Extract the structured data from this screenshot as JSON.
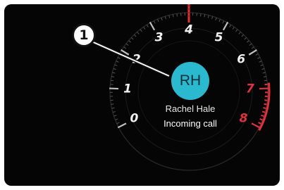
{
  "gauge": {
    "scale_labels": [
      "0",
      "1",
      "2",
      "3",
      "4",
      "5",
      "6",
      "7",
      "8"
    ],
    "redline_labels": [
      "7",
      "8"
    ],
    "colors": {
      "ticks": "#bfbfbf",
      "redline": "#e0323c",
      "background": "#050505"
    }
  },
  "incoming_call": {
    "initials": "RH",
    "caller_name": "Rachel Hale",
    "status": "Incoming call",
    "avatar_color": "#2ab9cf"
  },
  "callout": {
    "label": "1"
  }
}
